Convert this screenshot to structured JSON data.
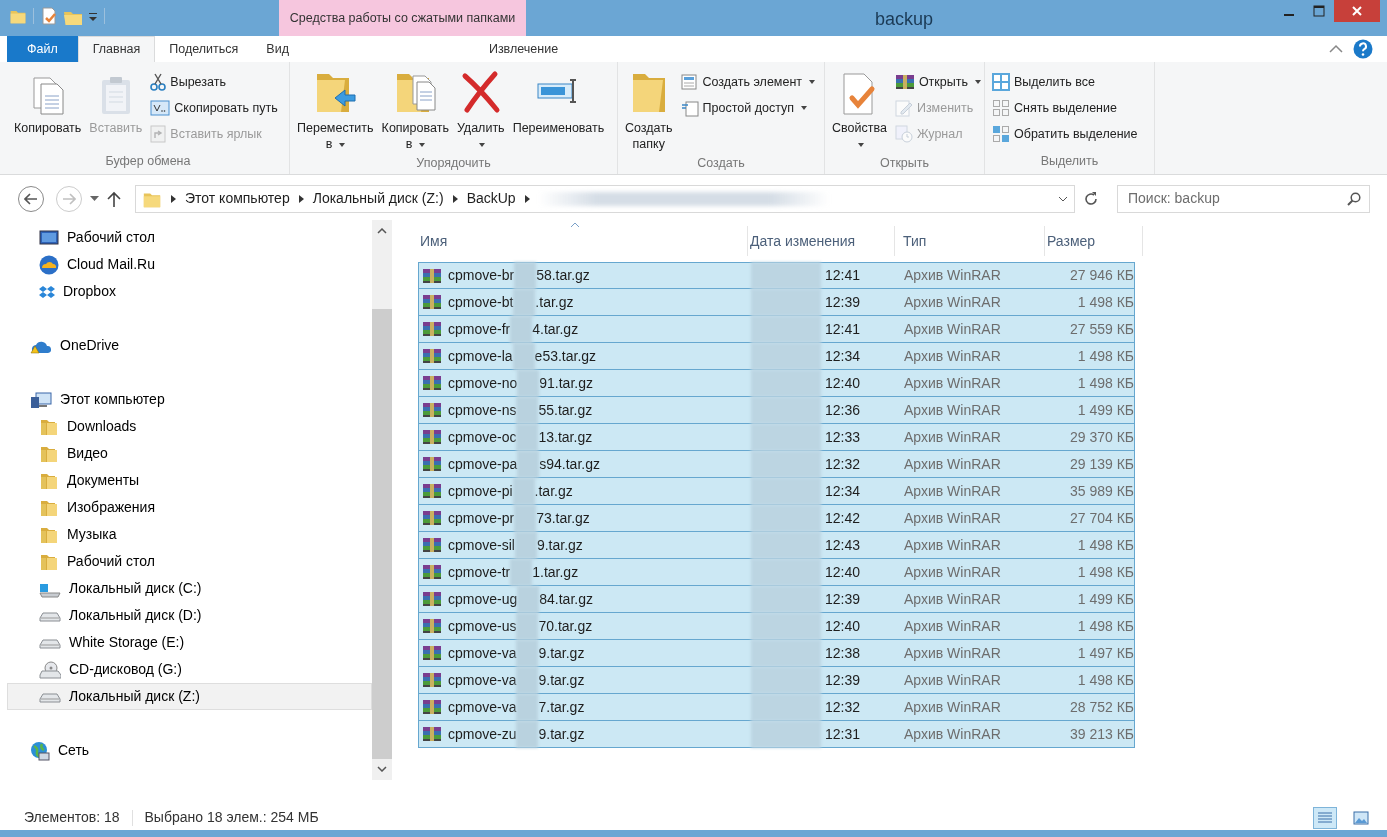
{
  "window": {
    "title": "backup"
  },
  "ribbon": {
    "context_title": "Средства работы со сжатыми папками",
    "tabs": [
      {
        "label": "Файл",
        "kind": "file",
        "selected": false
      },
      {
        "label": "Главная",
        "kind": "tab",
        "selected": true
      },
      {
        "label": "Поделиться",
        "kind": "tab",
        "selected": false
      },
      {
        "label": "Вид",
        "kind": "tab",
        "selected": false
      },
      {
        "label": "Извлечение",
        "kind": "context",
        "selected": false
      }
    ],
    "groups": [
      {
        "label": "Буфер обмена",
        "items": [
          {
            "kind": "large",
            "label": "Копировать",
            "disabled": false,
            "dropdown": false
          },
          {
            "kind": "large",
            "label": "Вставить",
            "disabled": true,
            "dropdown": false
          },
          {
            "kind": "stack",
            "items": [
              {
                "label": "Вырезать",
                "disabled": false,
                "dropdown": false
              },
              {
                "label": "Скопировать путь",
                "disabled": false,
                "dropdown": false
              },
              {
                "label": "Вставить ярлык",
                "disabled": true,
                "dropdown": false
              }
            ]
          }
        ]
      },
      {
        "label": "Упорядочить",
        "items": [
          {
            "kind": "large",
            "label": "Переместить в",
            "disabled": false,
            "dropdown": true
          },
          {
            "kind": "large",
            "label": "Копировать в",
            "disabled": false,
            "dropdown": true
          },
          {
            "kind": "large",
            "label": "Удалить",
            "disabled": false,
            "dropdown": true
          },
          {
            "kind": "large",
            "label": "Переименовать",
            "disabled": false,
            "dropdown": false
          }
        ]
      },
      {
        "label": "Создать",
        "items": [
          {
            "kind": "large",
            "label": "Создать папку",
            "disabled": false,
            "dropdown": false
          },
          {
            "kind": "stack",
            "items": [
              {
                "label": "Создать элемент",
                "disabled": false,
                "dropdown": true
              },
              {
                "label": "Простой доступ",
                "disabled": false,
                "dropdown": true
              }
            ]
          }
        ]
      },
      {
        "label": "Открыть",
        "items": [
          {
            "kind": "large",
            "label": "Свойства",
            "disabled": false,
            "dropdown": true
          },
          {
            "kind": "stack",
            "items": [
              {
                "label": "Открыть",
                "disabled": false,
                "dropdown": true
              },
              {
                "label": "Изменить",
                "disabled": true,
                "dropdown": false
              },
              {
                "label": "Журнал",
                "disabled": true,
                "dropdown": false
              }
            ]
          }
        ]
      },
      {
        "label": "Выделить",
        "items": [
          {
            "kind": "stack",
            "items": [
              {
                "label": "Выделить все",
                "disabled": false,
                "dropdown": false
              },
              {
                "label": "Снять выделение",
                "disabled": false,
                "dropdown": false
              },
              {
                "label": "Обратить выделение",
                "disabled": false,
                "dropdown": false
              }
            ]
          }
        ]
      }
    ]
  },
  "address": {
    "path": [
      "Этот компьютер",
      "Локальный диск (Z:)",
      "BackUp"
    ],
    "search": {
      "placeholder": "Поиск: backup"
    }
  },
  "favorites_items": [
    {
      "label": "Рабочий стол",
      "selected": false
    },
    {
      "label": "Cloud Mail.Ru",
      "selected": false
    },
    {
      "label": "Dropbox",
      "selected": false
    }
  ],
  "nav_tree": [
    {
      "label": "OneDrive",
      "selected": false
    },
    {
      "label": "Этот компьютер",
      "selected": false,
      "children": [
        {
          "label": "Downloads",
          "selected": false
        },
        {
          "label": "Видео",
          "selected": false
        },
        {
          "label": "Документы",
          "selected": false
        },
        {
          "label": "Изображения",
          "selected": false
        },
        {
          "label": "Музыка",
          "selected": false
        },
        {
          "label": "Рабочий стол",
          "selected": false
        },
        {
          "label": "Локальный диск (C:)",
          "selected": false
        },
        {
          "label": "Локальный диск (D:)",
          "selected": false
        },
        {
          "label": "White Storage (E:)",
          "selected": false
        },
        {
          "label": "CD-дисковод (G:)",
          "selected": false
        },
        {
          "label": "Локальный диск (Z:)",
          "selected": true
        }
      ]
    },
    {
      "label": "Сеть",
      "selected": false
    }
  ],
  "table": {
    "columns": [
      {
        "label": "Имя",
        "sorted": true
      },
      {
        "label": "Дата изменения",
        "sorted": false
      },
      {
        "label": "Тип",
        "sorted": false
      },
      {
        "label": "Размер",
        "sorted": false
      }
    ],
    "rows": [
      {
        "name_start": "cpmove-br",
        "name_end": "58.tar.gz",
        "time": "12:41",
        "type": "Архив WinRAR",
        "size": "27 946 КБ",
        "selected": true
      },
      {
        "name_start": "cpmove-bt",
        "name_end": ".tar.gz",
        "time": "12:39",
        "type": "Архив WinRAR",
        "size": "1 498 КБ",
        "selected": true
      },
      {
        "name_start": "cpmove-fr",
        "name_end": "4.tar.gz",
        "time": "12:41",
        "type": "Архив WinRAR",
        "size": "27 559 КБ",
        "selected": true
      },
      {
        "name_start": "cpmove-la",
        "name_end": "e53.tar.gz",
        "time": "12:34",
        "type": "Архив WinRAR",
        "size": "1 498 КБ",
        "selected": true
      },
      {
        "name_start": "cpmove-no",
        "name_end": "91.tar.gz",
        "time": "12:40",
        "type": "Архив WinRAR",
        "size": "1 498 КБ",
        "selected": true
      },
      {
        "name_start": "cpmove-ns",
        "name_end": "55.tar.gz",
        "time": "12:36",
        "type": "Архив WinRAR",
        "size": "1 499 КБ",
        "selected": true
      },
      {
        "name_start": "cpmove-oc",
        "name_end": "13.tar.gz",
        "time": "12:33",
        "type": "Архив WinRAR",
        "size": "29 370 КБ",
        "selected": true
      },
      {
        "name_start": "cpmove-pa",
        "name_end": "s94.tar.gz",
        "time": "12:32",
        "type": "Архив WinRAR",
        "size": "29 139 КБ",
        "selected": true
      },
      {
        "name_start": "cpmove-pi",
        "name_end": ".tar.gz",
        "time": "12:34",
        "type": "Архив WinRAR",
        "size": "35 989 КБ",
        "selected": true
      },
      {
        "name_start": "cpmove-pr",
        "name_end": "73.tar.gz",
        "time": "12:42",
        "type": "Архив WinRAR",
        "size": "27 704 КБ",
        "selected": true
      },
      {
        "name_start": "cpmove-sil",
        "name_end": "9.tar.gz",
        "time": "12:43",
        "type": "Архив WinRAR",
        "size": "1 498 КБ",
        "selected": true
      },
      {
        "name_start": "cpmove-tr",
        "name_end": "1.tar.gz",
        "time": "12:40",
        "type": "Архив WinRAR",
        "size": "1 498 КБ",
        "selected": true
      },
      {
        "name_start": "cpmove-ug",
        "name_end": "84.tar.gz",
        "time": "12:39",
        "type": "Архив WinRAR",
        "size": "1 499 КБ",
        "selected": true
      },
      {
        "name_start": "cpmove-us",
        "name_end": "70.tar.gz",
        "time": "12:40",
        "type": "Архив WinRAR",
        "size": "1 498 КБ",
        "selected": true
      },
      {
        "name_start": "cpmove-va",
        "name_end": "9.tar.gz",
        "time": "12:38",
        "type": "Архив WinRAR",
        "size": "1 497 КБ",
        "selected": true
      },
      {
        "name_start": "cpmove-va",
        "name_end": "9.tar.gz",
        "time": "12:39",
        "type": "Архив WinRAR",
        "size": "1 498 КБ",
        "selected": true
      },
      {
        "name_start": "cpmove-va",
        "name_end": "7.tar.gz",
        "time": "12:32",
        "type": "Архив WinRAR",
        "size": "28 752 КБ",
        "selected": true
      },
      {
        "name_start": "cpmove-zu",
        "name_end": "9.tar.gz",
        "time": "12:31",
        "type": "Архив WinRAR",
        "size": "39 213 КБ",
        "selected": true
      }
    ]
  },
  "status_bar": {
    "items_count": "Элементов: 18",
    "selection": "Выбрано 18 элем.: 254 МБ",
    "views": [
      {
        "kind": "details",
        "selected": true
      },
      {
        "kind": "icons",
        "selected": false
      }
    ]
  }
}
